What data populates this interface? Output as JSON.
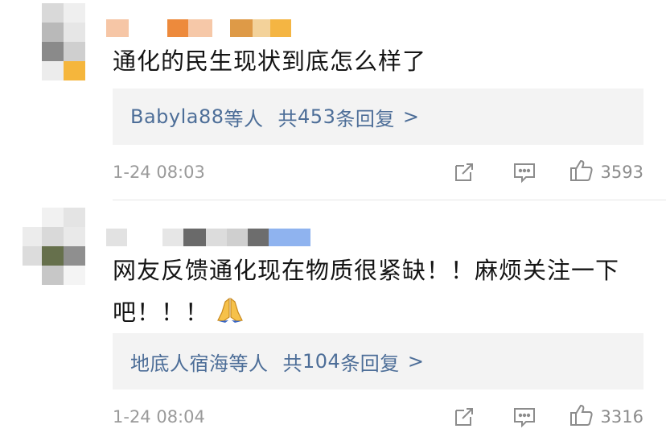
{
  "comments": [
    {
      "text": "通化的民生现状到底怎么样了",
      "replies": {
        "names": "Babyla88",
        "suffix": "等人",
        "prefix": "共",
        "count": "453",
        "unit": "条回复",
        "arrow": ">"
      },
      "time": "1-24 08:03",
      "likes": "3593"
    },
    {
      "text": "网友反馈通化现在物质很紧缺！！麻烦关注一下吧！！！",
      "replies": {
        "names": "地底人宿海",
        "suffix": "等人",
        "prefix": "共",
        "count": "104",
        "unit": "条回复",
        "arrow": ">"
      },
      "time": "1-24 08:04",
      "likes": "3316"
    }
  ],
  "icons": {
    "share": "share-icon",
    "comment": "comment-icon",
    "like": "thumbs-up-icon",
    "emoji": "folded-hands-emoji"
  },
  "colors": {
    "link": "#4d6e98",
    "text": "#141414",
    "meta": "#9a9a9a",
    "reply_bg": "#f3f3f3"
  }
}
